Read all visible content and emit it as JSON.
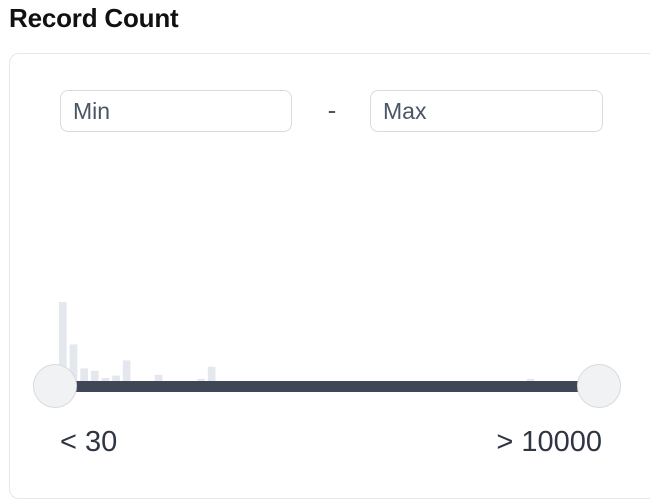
{
  "filter": {
    "title": "Record Count",
    "min_placeholder": "Min",
    "max_placeholder": "Max",
    "separator": "-",
    "range_min_label": "< 30",
    "range_max_label": "> 10000",
    "slider_min_fraction": 0,
    "slider_max_fraction": 1
  },
  "histogram": {
    "bar_color": "#e4e8ee",
    "bins": [
      1.0,
      0.47,
      0.17,
      0.14,
      0.05,
      0.08,
      0.27,
      0.0,
      0.0,
      0.09,
      0.0,
      0.0,
      0.0,
      0.04,
      0.19,
      0.0,
      0.0,
      0.0,
      0.0,
      0.0,
      0.0,
      0.0,
      0.0,
      0.0,
      0.0,
      0.0,
      0.0,
      0.0,
      0.0,
      0.0,
      0.0,
      0.0,
      0.0,
      0.0,
      0.0,
      0.0,
      0.0,
      0.0,
      0.0,
      0.0,
      0.0,
      0.0,
      0.0,
      0.0,
      0.04,
      0.0
    ]
  },
  "colors": {
    "track": "#3f4655",
    "thumb": "#f1f2f4"
  }
}
